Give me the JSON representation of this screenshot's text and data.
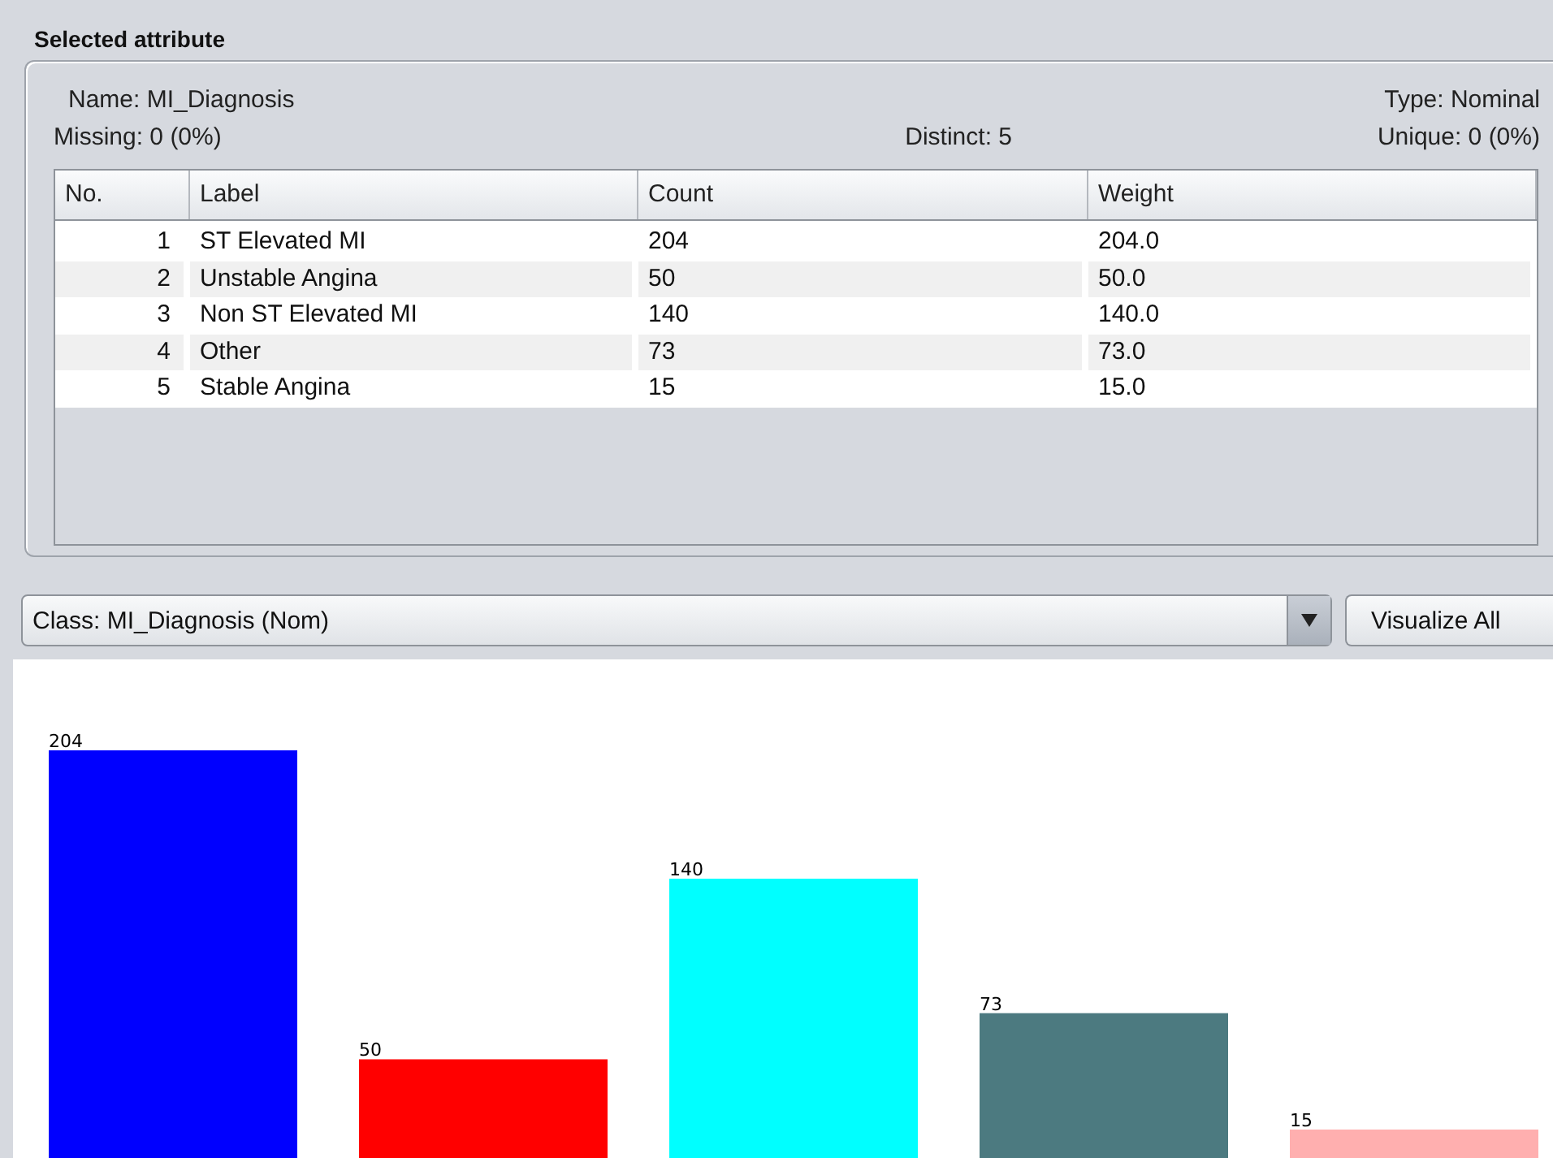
{
  "panel": {
    "title": "Selected attribute",
    "name": "Name: MI_Diagnosis",
    "type": "Type: Nominal",
    "missing": "Missing: 0 (0%)",
    "distinct": "Distinct: 5",
    "unique": "Unique: 0 (0%)"
  },
  "table": {
    "columns": [
      "No.",
      "Label",
      "Count",
      "Weight"
    ],
    "rows": [
      {
        "no": "1",
        "label": "ST Elevated MI",
        "count": "204",
        "weight": "204.0"
      },
      {
        "no": "2",
        "label": "Unstable Angina",
        "count": "50",
        "weight": "50.0"
      },
      {
        "no": "3",
        "label": "Non ST Elevated MI",
        "count": "140",
        "weight": "140.0"
      },
      {
        "no": "4",
        "label": "Other",
        "count": "73",
        "weight": "73.0"
      },
      {
        "no": "5",
        "label": "Stable Angina",
        "count": "15",
        "weight": "15.0"
      }
    ]
  },
  "class_select": {
    "value": "Class: MI_Diagnosis (Nom)"
  },
  "visualize_button": "Visualize All",
  "chart": {
    "chart_data": {
      "type": "bar",
      "values": [
        204,
        50,
        140,
        73,
        15
      ],
      "colors": [
        "#0000ff",
        "#ff0000",
        "#00ffff",
        "#4c7a80",
        "#ffafaf"
      ],
      "data_labels": true
    }
  }
}
